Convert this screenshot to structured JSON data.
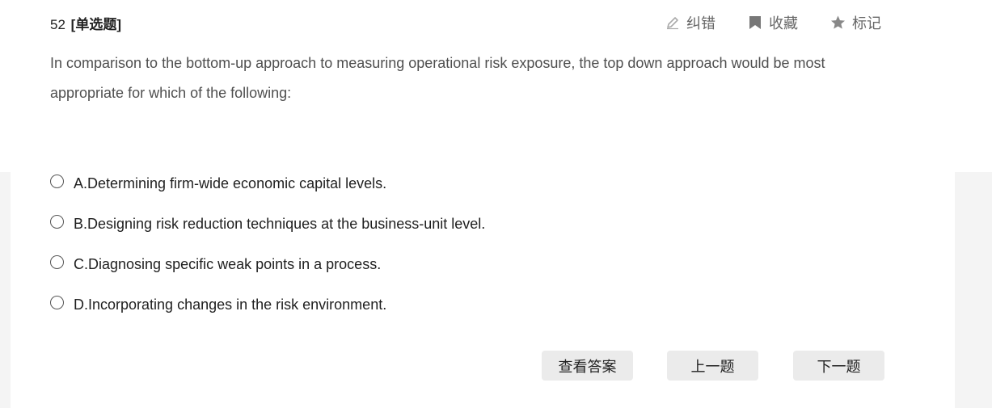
{
  "question": {
    "number": "52",
    "type_label": "[单选题]",
    "stem": "In comparison to the bottom-up approach to measuring operational risk exposure, the top down approach would be most appropriate for which of the following:"
  },
  "toolbar": {
    "correct_label": "纠错",
    "collect_label": "收藏",
    "mark_label": "标记"
  },
  "options": [
    {
      "text": "A.Determining firm-wide economic capital levels."
    },
    {
      "text": "B.Designing risk reduction techniques at the business-unit level."
    },
    {
      "text": "C.Diagnosing specific weak points in a process."
    },
    {
      "text": "D.Incorporating changes in the risk environment."
    }
  ],
  "buttons": {
    "view_answer": "查看答案",
    "prev": "上一题",
    "next": "下一题"
  },
  "colors": {
    "page_background": "#f4f4f4",
    "card_background": "#ffffff",
    "button_background": "#ebebeb",
    "icon_gray": "#888888"
  },
  "icons": {
    "correct": "pencil-icon",
    "collect": "bookmark-icon",
    "mark": "star-icon"
  }
}
